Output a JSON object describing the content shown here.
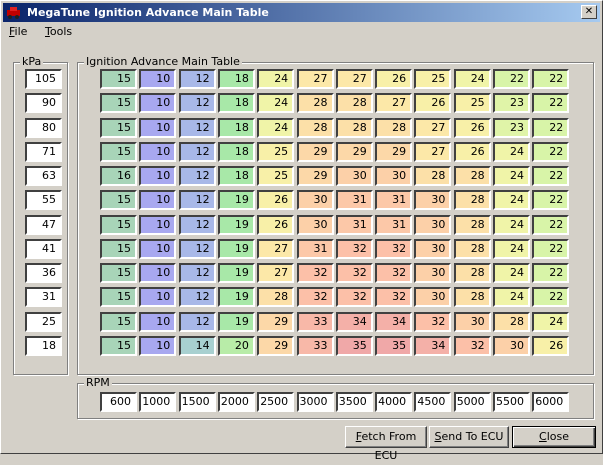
{
  "window": {
    "title": "MegaTune Ignition Advance Main Table",
    "close_glyph": "✕"
  },
  "menu": {
    "file": {
      "accel": "F",
      "rest": "ile"
    },
    "tools": {
      "accel": "T",
      "rest": "ools"
    }
  },
  "kpa": {
    "label": "kPa",
    "values": [
      "105",
      "90",
      "80",
      "71",
      "63",
      "55",
      "47",
      "41",
      "36",
      "31",
      "25",
      "18"
    ]
  },
  "table": {
    "label": "Ignition Advance Main Table",
    "rows": [
      [
        15,
        10,
        12,
        18,
        24,
        27,
        27,
        26,
        25,
        24,
        22,
        22
      ],
      [
        15,
        10,
        12,
        18,
        24,
        28,
        28,
        27,
        26,
        25,
        23,
        22
      ],
      [
        15,
        10,
        12,
        18,
        24,
        28,
        28,
        28,
        27,
        26,
        23,
        22
      ],
      [
        15,
        10,
        12,
        18,
        25,
        29,
        29,
        29,
        27,
        26,
        24,
        22
      ],
      [
        16,
        10,
        12,
        18,
        25,
        29,
        30,
        30,
        28,
        28,
        24,
        22
      ],
      [
        15,
        10,
        12,
        19,
        26,
        30,
        31,
        31,
        30,
        28,
        24,
        22
      ],
      [
        15,
        10,
        12,
        19,
        26,
        30,
        31,
        31,
        30,
        28,
        24,
        22
      ],
      [
        15,
        10,
        12,
        19,
        27,
        31,
        32,
        32,
        30,
        28,
        24,
        22
      ],
      [
        15,
        10,
        12,
        19,
        27,
        32,
        32,
        32,
        30,
        28,
        24,
        22
      ],
      [
        15,
        10,
        12,
        19,
        28,
        32,
        32,
        32,
        30,
        28,
        24,
        22
      ],
      [
        15,
        10,
        12,
        19,
        29,
        33,
        34,
        34,
        32,
        30,
        28,
        24
      ],
      [
        15,
        10,
        14,
        20,
        29,
        33,
        35,
        35,
        34,
        32,
        30,
        26
      ]
    ],
    "colors": {
      "10": "#a8a8f0",
      "12": "#a8b8e8",
      "14": "#a8d0d0",
      "15": "#a8d4b8",
      "16": "#a8d4b8",
      "18": "#a8e8a8",
      "19": "#a8e8a8",
      "20": "#b8eca8",
      "22": "#d8f4a8",
      "23": "#e0f4a8",
      "24": "#f0f4a8",
      "25": "#f8f0a8",
      "26": "#f8f0a8",
      "27": "#fce8a8",
      "28": "#fce0a8",
      "29": "#fcd8a8",
      "30": "#fcd0a8",
      "31": "#fcc8a8",
      "32": "#fcc0a8",
      "33": "#f8b8a8",
      "34": "#f4b0a8",
      "35": "#f0a8a8"
    }
  },
  "rpm": {
    "label": "RPM",
    "values": [
      "600",
      "1000",
      "1500",
      "2000",
      "2500",
      "3000",
      "3500",
      "4000",
      "4500",
      "5000",
      "5500",
      "6000"
    ]
  },
  "buttons": {
    "fetch": {
      "accel": "F",
      "rest": "etch From ECU"
    },
    "send": {
      "accel": "S",
      "rest": "end To ECU"
    },
    "close": {
      "accel": "C",
      "rest": "lose"
    }
  }
}
